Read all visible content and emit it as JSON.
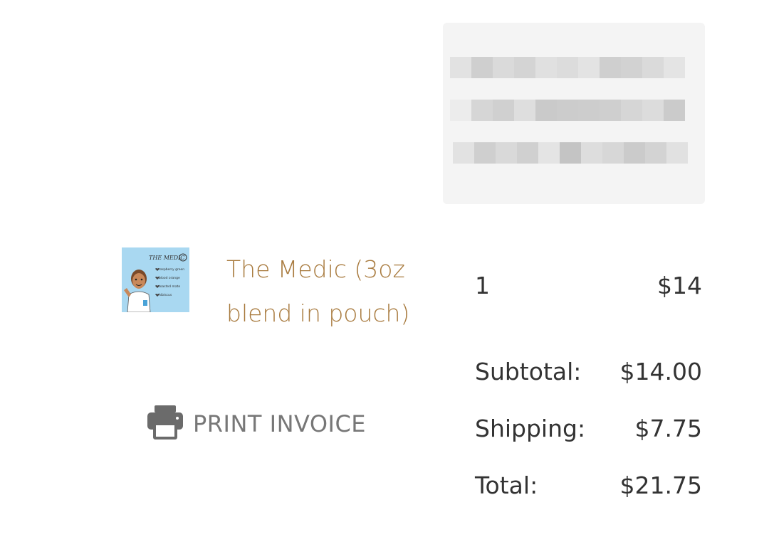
{
  "order": {
    "items": [
      {
        "name": "The Medic (3oz blend in pouch)",
        "quantity": "1",
        "price": "$14",
        "thumbnail": {
          "title": "THE MEDIC",
          "lines": [
            "raspberry green",
            "blood orange",
            "toasted mate",
            "hibiscus"
          ]
        }
      }
    ],
    "subtotal_label": "Subtotal:",
    "subtotal_value": "$14.00",
    "shipping_label": "Shipping:",
    "shipping_value": "$7.75",
    "total_label": "Total:",
    "total_value": "$21.75"
  },
  "actions": {
    "print_invoice_label": "PRINT INVOICE",
    "print_icon": "printer-icon"
  },
  "colors": {
    "product_link": "#a87a3e",
    "text": "#333333",
    "muted": "#777777",
    "thumb_bg": "#a9d8f1"
  }
}
